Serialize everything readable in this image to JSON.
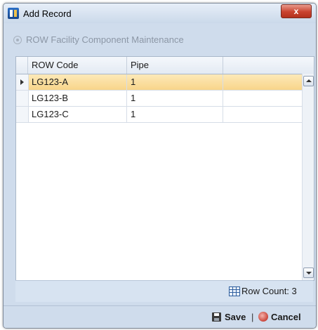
{
  "window": {
    "title": "Add Record",
    "close_symbol": "x"
  },
  "section": {
    "title": "ROW Facility Component Maintenance"
  },
  "grid": {
    "columns": [
      "ROW Code",
      "Pipe"
    ],
    "rows": [
      {
        "row_code": "LG123-A",
        "pipe": "1",
        "selected": true
      },
      {
        "row_code": "LG123-B",
        "pipe": "1",
        "selected": false
      },
      {
        "row_code": "LG123-C",
        "pipe": "1",
        "selected": false
      }
    ]
  },
  "status": {
    "row_count_label": "Row Count: 3"
  },
  "footer": {
    "save_label": "Save",
    "separator": "|",
    "cancel_label": "Cancel"
  },
  "icons": {
    "app": "app-icon",
    "section": "radio-icon",
    "row_count": "grid-icon",
    "save": "floppy-disk-icon",
    "cancel": "cancel-icon"
  },
  "colors": {
    "selected_row": "#f8d58a",
    "window_background": "#cfdcec",
    "close_button": "#c9432f"
  }
}
